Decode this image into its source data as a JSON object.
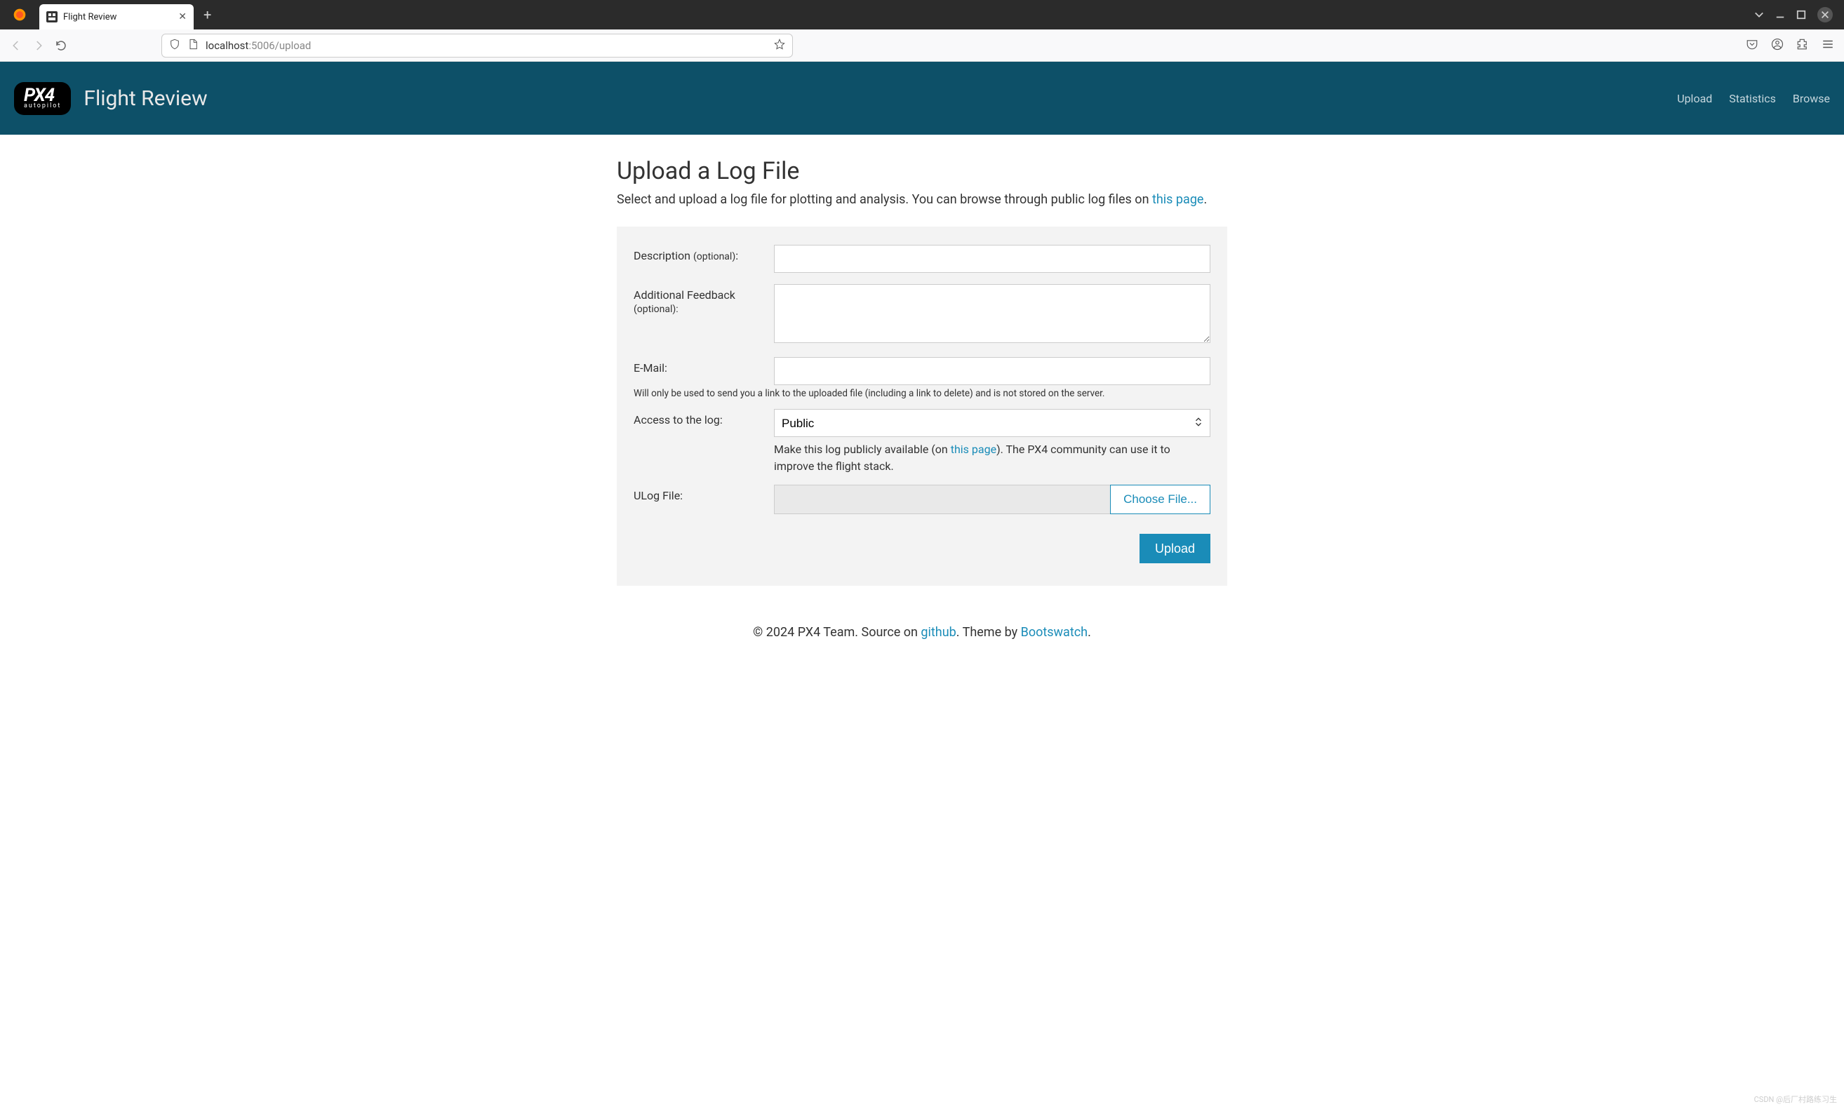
{
  "browser": {
    "tab_title": "Flight Review",
    "url_host": "localhost",
    "url_port_path": ":5006/upload"
  },
  "header": {
    "logo_main": "PX4",
    "logo_sub": "autopilot",
    "title": "Flight Review",
    "nav": {
      "upload": "Upload",
      "statistics": "Statistics",
      "browse": "Browse"
    }
  },
  "page": {
    "title": "Upload a Log File",
    "desc_before": "Select and upload a log file for plotting and analysis. You can browse through public log files on ",
    "desc_link": "this page",
    "desc_after": "."
  },
  "form": {
    "description": {
      "label": "Description ",
      "opt": "(optional)",
      "colon": ":"
    },
    "feedback": {
      "label": "Additional Feedback",
      "opt": "(optional)",
      "colon": ":"
    },
    "email": {
      "label": "E-Mail:",
      "help": "Will only be used to send you a link to the uploaded file (including a link to delete) and is not stored on the server."
    },
    "access": {
      "label": "Access to the log:",
      "selected": "Public",
      "help_before": "Make this log publicly available (on ",
      "help_link": "this page",
      "help_after": "). The PX4 community can use it to improve the flight stack."
    },
    "ulog": {
      "label": "ULog File:",
      "button": "Choose File..."
    },
    "submit": "Upload"
  },
  "footer": {
    "copyright": "© 2024 PX4 Team. Source on ",
    "link1": "github",
    "mid": ". Theme by ",
    "link2": "Bootswatch",
    "end": "."
  },
  "watermark": "CSDN @后厂村路练习生"
}
